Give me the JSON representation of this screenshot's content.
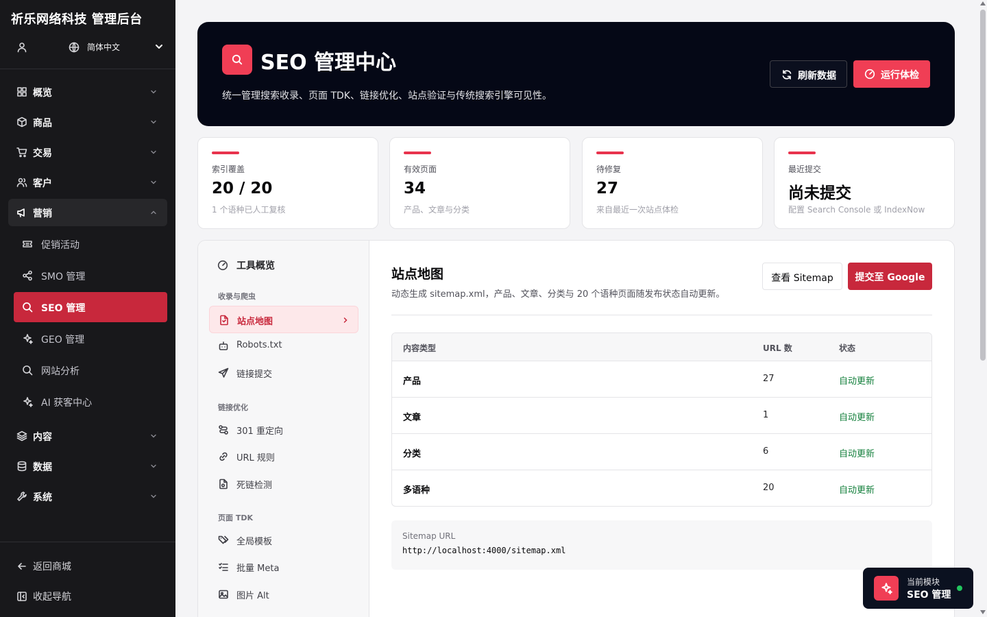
{
  "sidebar": {
    "brand": "祈乐网络科技 管理后台",
    "language": "简体中文",
    "nav": [
      {
        "label": "概览",
        "icon": "grid-icon"
      },
      {
        "label": "商品",
        "icon": "box-icon"
      },
      {
        "label": "交易",
        "icon": "cart-icon"
      },
      {
        "label": "客户",
        "icon": "users-icon"
      },
      {
        "label": "营销",
        "icon": "megaphone-icon"
      },
      {
        "label": "内容",
        "icon": "layers-icon"
      },
      {
        "label": "数据",
        "icon": "database-icon"
      },
      {
        "label": "系统",
        "icon": "wrench-icon"
      }
    ],
    "marketing_sub": [
      {
        "label": "促销活动",
        "icon": "ticket-icon"
      },
      {
        "label": "SMO 管理",
        "icon": "share-icon"
      },
      {
        "label": "SEO 管理",
        "icon": "search-icon"
      },
      {
        "label": "GEO 管理",
        "icon": "sparkle-icon"
      },
      {
        "label": "网站分析",
        "icon": "search-icon"
      },
      {
        "label": "AI 获客中心",
        "icon": "sparkle-icon"
      }
    ],
    "footer": {
      "back": "返回商城",
      "collapse": "收起导航"
    }
  },
  "hero": {
    "title": "SEO 管理中心",
    "desc": "统一管理搜索收录、页面 TDK、链接优化、站点验证与传统搜索引擎可见性。",
    "refresh_label": "刷新数据",
    "check_label": "运行体检",
    "accent": "#f03e55"
  },
  "stats": [
    {
      "label": "索引覆盖",
      "value": "20 / 20",
      "sub": "1 个语种已人工复核"
    },
    {
      "label": "有效页面",
      "value": "34",
      "sub": "产品、文章与分类"
    },
    {
      "label": "待修复",
      "value": "27",
      "sub": "来自最近一次站点体检"
    },
    {
      "label": "最近提交",
      "value": "尚未提交",
      "sub": "配置 Search Console 或 IndexNow"
    }
  ],
  "tools": {
    "overview": "工具概览",
    "groups": [
      {
        "title": "收录与爬虫",
        "items": [
          "站点地图",
          "Robots.txt",
          "链接提交"
        ]
      },
      {
        "title": "链接优化",
        "items": [
          "301 重定向",
          "URL 规则",
          "死链检测"
        ]
      },
      {
        "title": "页面 TDK",
        "items": [
          "全局模板",
          "批量 Meta",
          "图片 Alt"
        ]
      }
    ]
  },
  "sitemap": {
    "title": "站点地图",
    "desc": "动态生成 sitemap.xml，产品、文章、分类与 20 个语种页面随发布状态自动更新。",
    "view_label": "查看 Sitemap",
    "submit_label": "提交至 Google",
    "columns": [
      "内容类型",
      "URL 数",
      "状态"
    ],
    "rows": [
      {
        "type": "产品",
        "count": "27",
        "status": "自动更新"
      },
      {
        "type": "文章",
        "count": "1",
        "status": "自动更新"
      },
      {
        "type": "分类",
        "count": "6",
        "status": "自动更新"
      },
      {
        "type": "多语种",
        "count": "20",
        "status": "自动更新"
      }
    ],
    "url_label": "Sitemap URL",
    "url": "http://localhost:4000/sitemap.xml"
  },
  "module_toast": {
    "label": "当前模块",
    "value": "SEO 管理"
  }
}
